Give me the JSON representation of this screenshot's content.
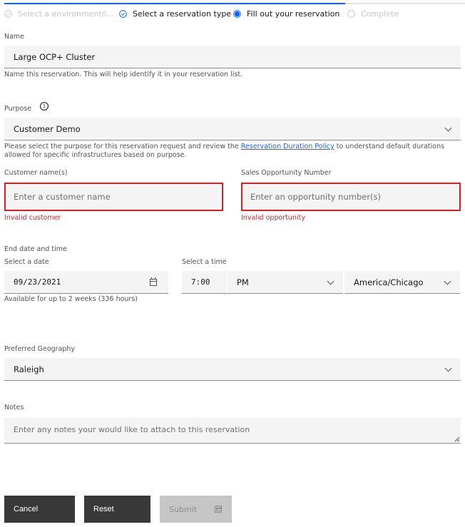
{
  "progress": {
    "fraction_complete": 0.74,
    "steps": [
      {
        "label": "Select a environment/i...",
        "state": "complete-faded"
      },
      {
        "label": "Select a reservation type",
        "state": "complete"
      },
      {
        "label": "Fill out your reservation",
        "state": "current"
      },
      {
        "label": "Complete",
        "state": "incomplete"
      }
    ]
  },
  "name": {
    "label": "Name",
    "value": "Large OCP+ Cluster",
    "helper": "Name this reservation. This will help identify it in your reservation list."
  },
  "purpose": {
    "label": "Purpose",
    "value": "Customer Demo",
    "helper_before": "Please select the purpose for this reservation request and review the ",
    "helper_link": "Reservation Duration Policy",
    "helper_after": " to understand default durations allowed for specific infrastructures based on purpose."
  },
  "customer": {
    "label": "Customer name(s)",
    "placeholder": "Enter a customer name",
    "error": "Invalid customer"
  },
  "opportunity": {
    "label": "Sales Opportunity Number",
    "placeholder": "Enter an opportunity number(s)",
    "error": "Invalid opportunity"
  },
  "end": {
    "label": "End date and time",
    "date_label": "Select a date",
    "date_value": "09/23/2021",
    "date_helper": "Available for up to 2 weeks (336 hours)",
    "time_label": "Select a time",
    "time_value": "7:00",
    "ampm_value": "PM",
    "timezone_value": "America/Chicago"
  },
  "geography": {
    "label": "Preferred Geography",
    "value": "Raleigh"
  },
  "notes": {
    "label": "Notes",
    "placeholder": "Enter any notes your would like to attach to this reservation"
  },
  "buttons": {
    "cancel": "Cancel",
    "reset": "Reset",
    "submit": "Submit"
  },
  "colors": {
    "accent": "#0f62fe",
    "error": "#da1e28",
    "button_dark": "#393939",
    "button_disabled": "#c6c6c6"
  }
}
